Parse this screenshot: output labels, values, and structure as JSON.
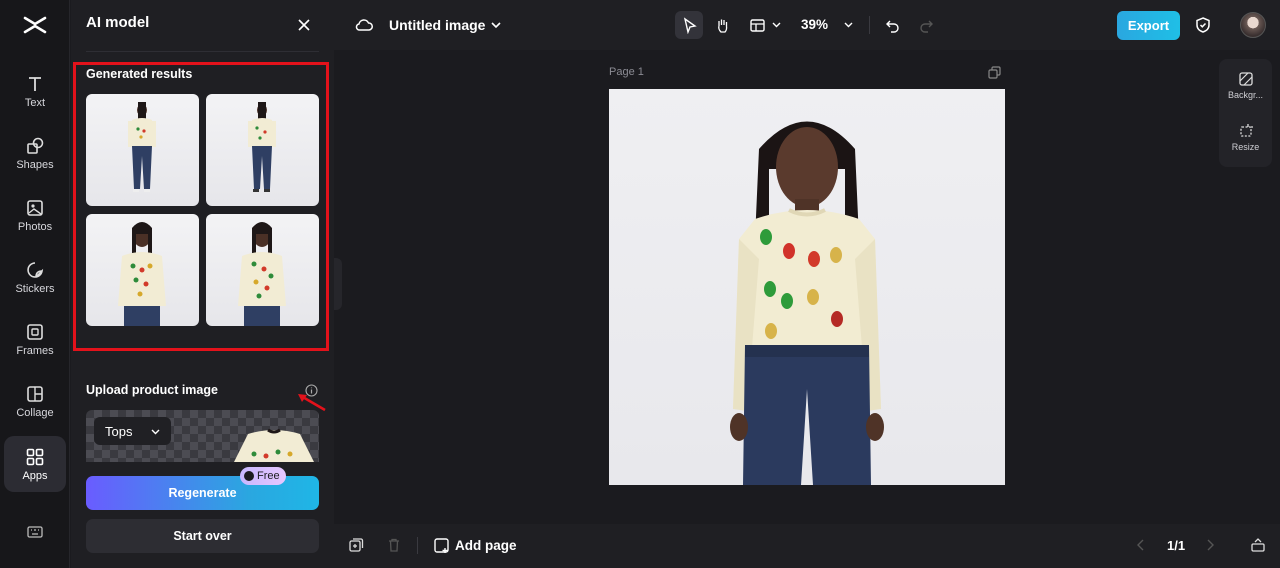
{
  "rail": {
    "items": [
      {
        "label": "Text",
        "icon": "text-icon"
      },
      {
        "label": "Shapes",
        "icon": "shapes-icon"
      },
      {
        "label": "Photos",
        "icon": "photos-icon"
      },
      {
        "label": "Stickers",
        "icon": "stickers-icon"
      },
      {
        "label": "Frames",
        "icon": "frames-icon"
      },
      {
        "label": "Collage",
        "icon": "collage-icon"
      },
      {
        "label": "Apps",
        "icon": "apps-icon"
      }
    ]
  },
  "panel": {
    "title": "AI model",
    "results_title": "Generated results",
    "upload_title": "Upload product image",
    "category_select": "Tops",
    "regenerate_label": "Regenerate",
    "free_badge": "Free",
    "start_over_label": "Start over"
  },
  "topbar": {
    "doc_title": "Untitled image",
    "zoom": "39%",
    "export_label": "Export"
  },
  "canvas": {
    "page_label": "Page 1"
  },
  "right_tools": {
    "background_label": "Backgr...",
    "resize_label": "Resize"
  },
  "bottombar": {
    "add_page_label": "Add page",
    "page_count": "1/1"
  },
  "colors": {
    "accent": "#2aa7e0",
    "highlight": "#e3121b",
    "regenerate_start": "#6a5cff"
  }
}
